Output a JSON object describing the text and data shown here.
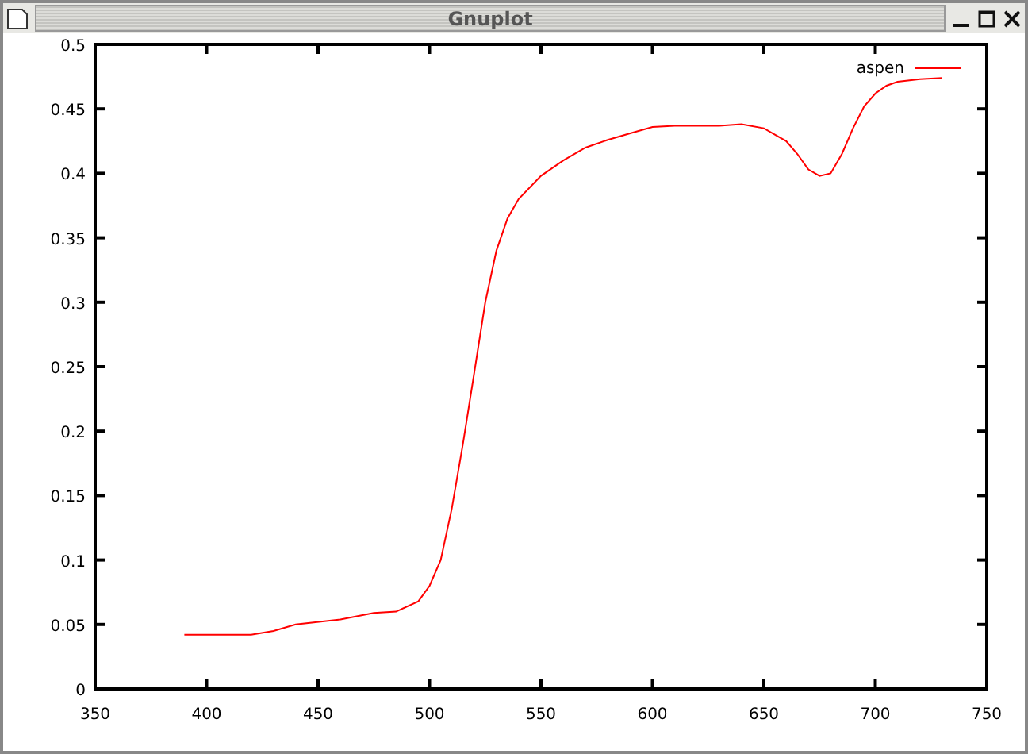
{
  "window": {
    "title": "Gnuplot"
  },
  "plot": {
    "chart_data": {
      "type": "line",
      "xlim": [
        350,
        750
      ],
      "ylim": [
        0,
        0.5
      ],
      "xticks": [
        350,
        400,
        450,
        500,
        550,
        600,
        650,
        700,
        750
      ],
      "yticks": [
        0,
        0.05,
        0.1,
        0.15,
        0.2,
        0.25,
        0.3,
        0.35,
        0.4,
        0.45,
        0.5
      ],
      "x": [
        390,
        420,
        430,
        440,
        460,
        475,
        485,
        495,
        500,
        505,
        510,
        515,
        520,
        525,
        530,
        535,
        540,
        550,
        560,
        570,
        580,
        590,
        600,
        610,
        620,
        630,
        640,
        650,
        660,
        665,
        670,
        675,
        680,
        685,
        690,
        695,
        700,
        705,
        710,
        720,
        730
      ],
      "series": [
        {
          "name": "aspen",
          "color": "#ff0000",
          "values": [
            0.042,
            0.042,
            0.045,
            0.05,
            0.054,
            0.059,
            0.06,
            0.068,
            0.08,
            0.1,
            0.14,
            0.19,
            0.245,
            0.3,
            0.34,
            0.365,
            0.38,
            0.398,
            0.41,
            0.42,
            0.426,
            0.431,
            0.436,
            0.437,
            0.437,
            0.437,
            0.438,
            0.435,
            0.425,
            0.415,
            0.403,
            0.398,
            0.4,
            0.415,
            0.435,
            0.452,
            0.462,
            0.468,
            0.471,
            0.473,
            0.474
          ]
        }
      ]
    }
  }
}
